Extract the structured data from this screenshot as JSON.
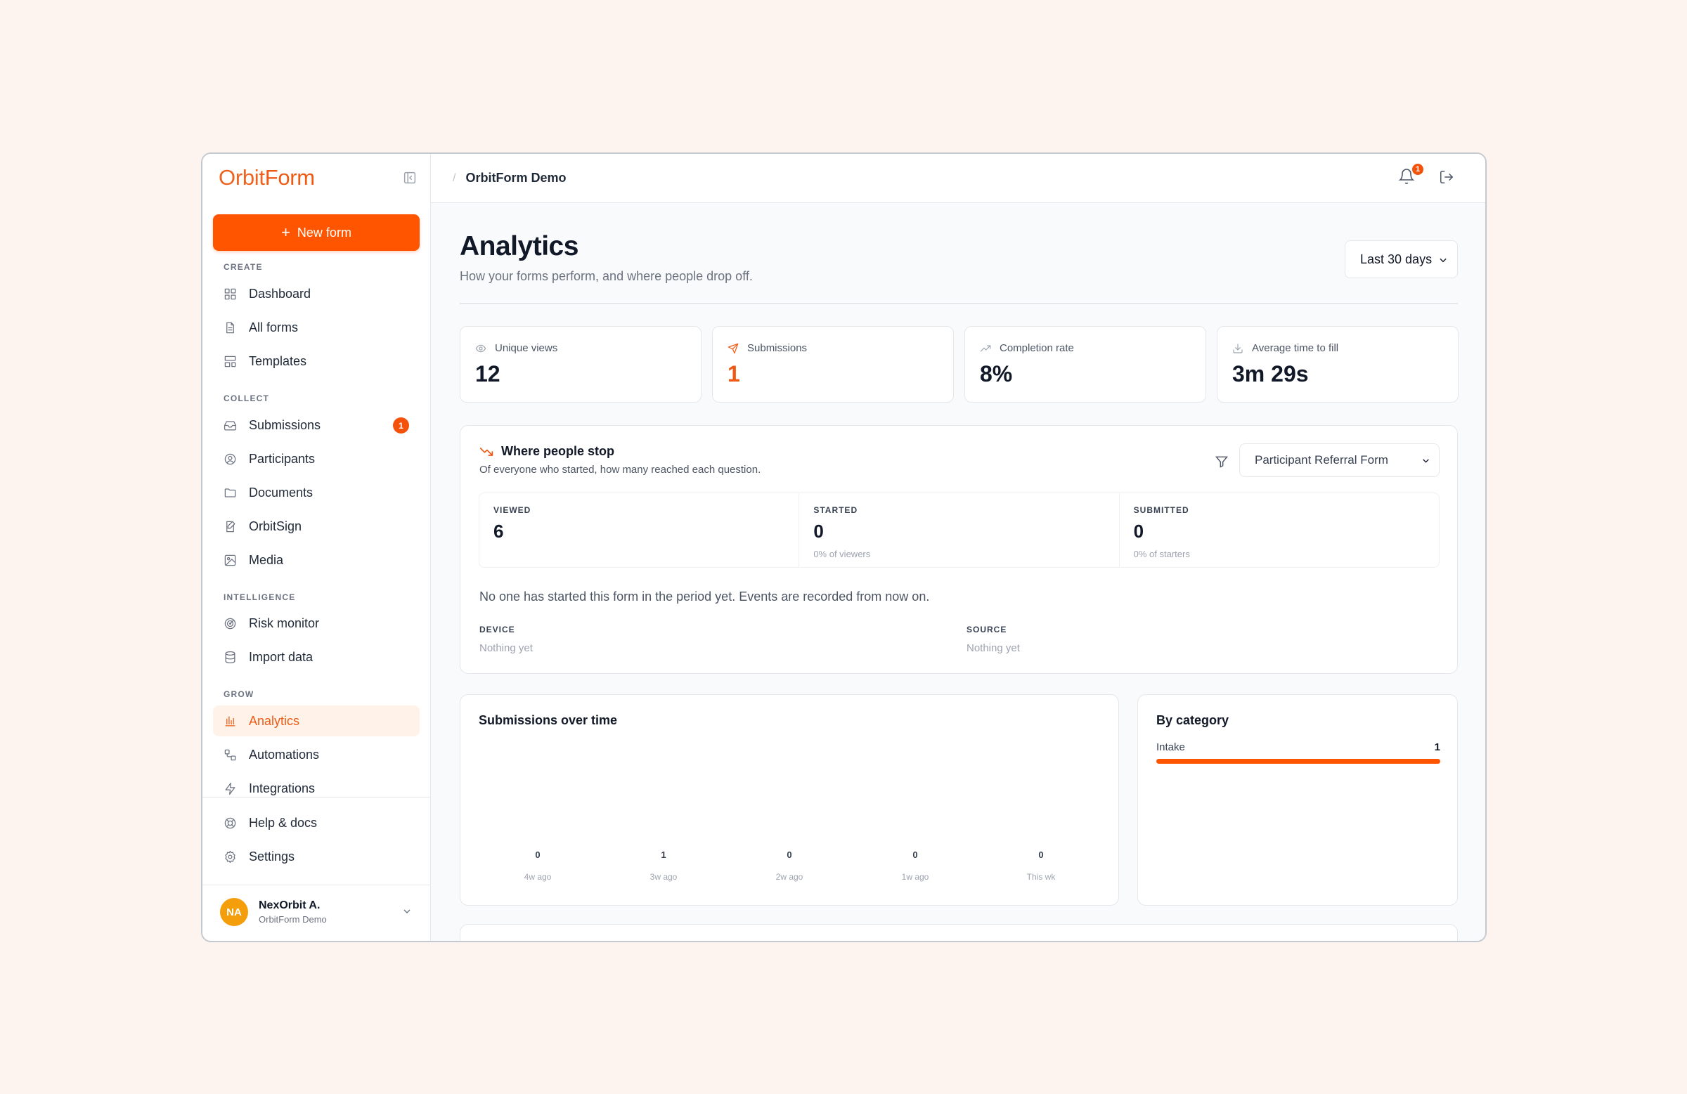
{
  "app": {
    "logo_part1": "Orbit",
    "logo_part2": "Form",
    "accent_color": "#ff5500"
  },
  "sidebar": {
    "new_form_label": "New form",
    "sections": {
      "create": "CREATE",
      "collect": "COLLECT",
      "intelligence": "INTELLIGENCE",
      "grow": "GROW"
    },
    "items": {
      "dashboard": "Dashboard",
      "all_forms": "All forms",
      "templates": "Templates",
      "submissions": "Submissions",
      "submissions_badge": "1",
      "participants": "Participants",
      "documents": "Documents",
      "orbitsign": "OrbitSign",
      "media": "Media",
      "risk_monitor": "Risk monitor",
      "import_data": "Import data",
      "analytics": "Analytics",
      "automations": "Automations",
      "integrations": "Integrations",
      "help": "Help & docs",
      "settings": "Settings"
    },
    "active_item": "analytics",
    "user": {
      "initials": "NA",
      "name": "NexOrbit A.",
      "org": "OrbitForm Demo"
    }
  },
  "topbar": {
    "breadcrumb_sep": "/",
    "breadcrumb": "OrbitForm Demo",
    "notification_count": "1"
  },
  "page": {
    "title": "Analytics",
    "subtitle": "How your forms perform, and where people drop off.",
    "range_label": "Last 30 days"
  },
  "stats": [
    {
      "label": "Unique views",
      "value": "12",
      "icon": "eye-icon"
    },
    {
      "label": "Submissions",
      "value": "1",
      "icon": "send-icon"
    },
    {
      "label": "Completion rate",
      "value": "8%",
      "icon": "trending-up-icon"
    },
    {
      "label": "Average time to fill",
      "value": "3m 29s",
      "icon": "download-icon"
    }
  ],
  "funnel": {
    "title": "Where people stop",
    "subtitle": "Of everyone who started, how many reached each question.",
    "form_select": "Participant Referral Form",
    "columns": [
      {
        "label": "VIEWED",
        "value": "6",
        "sub": ""
      },
      {
        "label": "STARTED",
        "value": "0",
        "sub": "0% of viewers"
      },
      {
        "label": "SUBMITTED",
        "value": "0",
        "sub": "0% of starters"
      }
    ],
    "note": "No one has started this form in the period yet. Events are recorded from now on.",
    "device_label": "DEVICE",
    "device_value": "Nothing yet",
    "source_label": "SOURCE",
    "source_value": "Nothing yet"
  },
  "submissions_chart": {
    "title": "Submissions over time"
  },
  "chart_data": {
    "type": "bar",
    "categories": [
      "4w ago",
      "3w ago",
      "2w ago",
      "1w ago",
      "This wk"
    ],
    "values": [
      0,
      1,
      0,
      0,
      0
    ],
    "title": "Submissions over time",
    "xlabel": "",
    "ylabel": ""
  },
  "by_category": {
    "title": "By category",
    "items": [
      {
        "label": "Intake",
        "count": "1",
        "fraction": 1.0
      }
    ]
  }
}
